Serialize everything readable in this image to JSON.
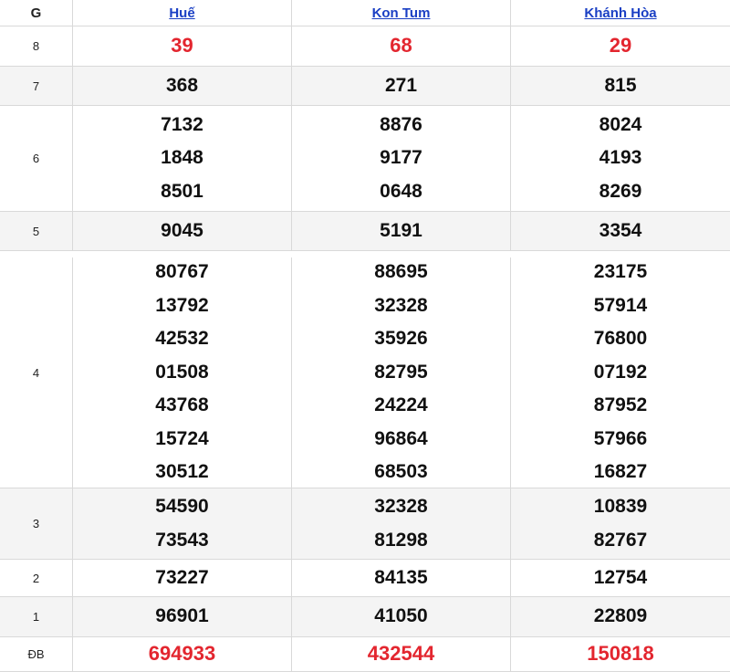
{
  "header": {
    "prize_col": "G",
    "provinces": [
      "Huế",
      "Kon Tum",
      "Khánh Hòa"
    ]
  },
  "colors": {
    "link": "#1a3fc4",
    "highlight": "#e3262f"
  },
  "rows": [
    {
      "prize": "8",
      "values": [
        [
          "39"
        ],
        [
          "68"
        ],
        [
          "29"
        ]
      ],
      "highlight": true
    },
    {
      "prize": "7",
      "values": [
        [
          "368"
        ],
        [
          "271"
        ],
        [
          "815"
        ]
      ]
    },
    {
      "prize": "6",
      "values": [
        [
          "7132",
          "1848",
          "8501"
        ],
        [
          "8876",
          "9177",
          "0648"
        ],
        [
          "8024",
          "4193",
          "8269"
        ]
      ]
    },
    {
      "prize": "5",
      "values": [
        [
          "9045"
        ],
        [
          "5191"
        ],
        [
          "3354"
        ]
      ]
    },
    {
      "prize": "4",
      "values": [
        [
          "80767",
          "13792",
          "42532",
          "01508",
          "43768",
          "15724",
          "30512"
        ],
        [
          "88695",
          "32328",
          "35926",
          "82795",
          "24224",
          "96864",
          "68503"
        ],
        [
          "23175",
          "57914",
          "76800",
          "07192",
          "87952",
          "57966",
          "16827"
        ]
      ]
    },
    {
      "prize": "3",
      "values": [
        [
          "54590",
          "73543"
        ],
        [
          "32328",
          "81298"
        ],
        [
          "10839",
          "82767"
        ]
      ]
    },
    {
      "prize": "2",
      "values": [
        [
          "73227"
        ],
        [
          "84135"
        ],
        [
          "12754"
        ]
      ]
    },
    {
      "prize": "1",
      "values": [
        [
          "96901"
        ],
        [
          "41050"
        ],
        [
          "22809"
        ]
      ]
    },
    {
      "prize": "ĐB",
      "values": [
        [
          "694933"
        ],
        [
          "432544"
        ],
        [
          "150818"
        ]
      ],
      "highlight": true
    }
  ]
}
